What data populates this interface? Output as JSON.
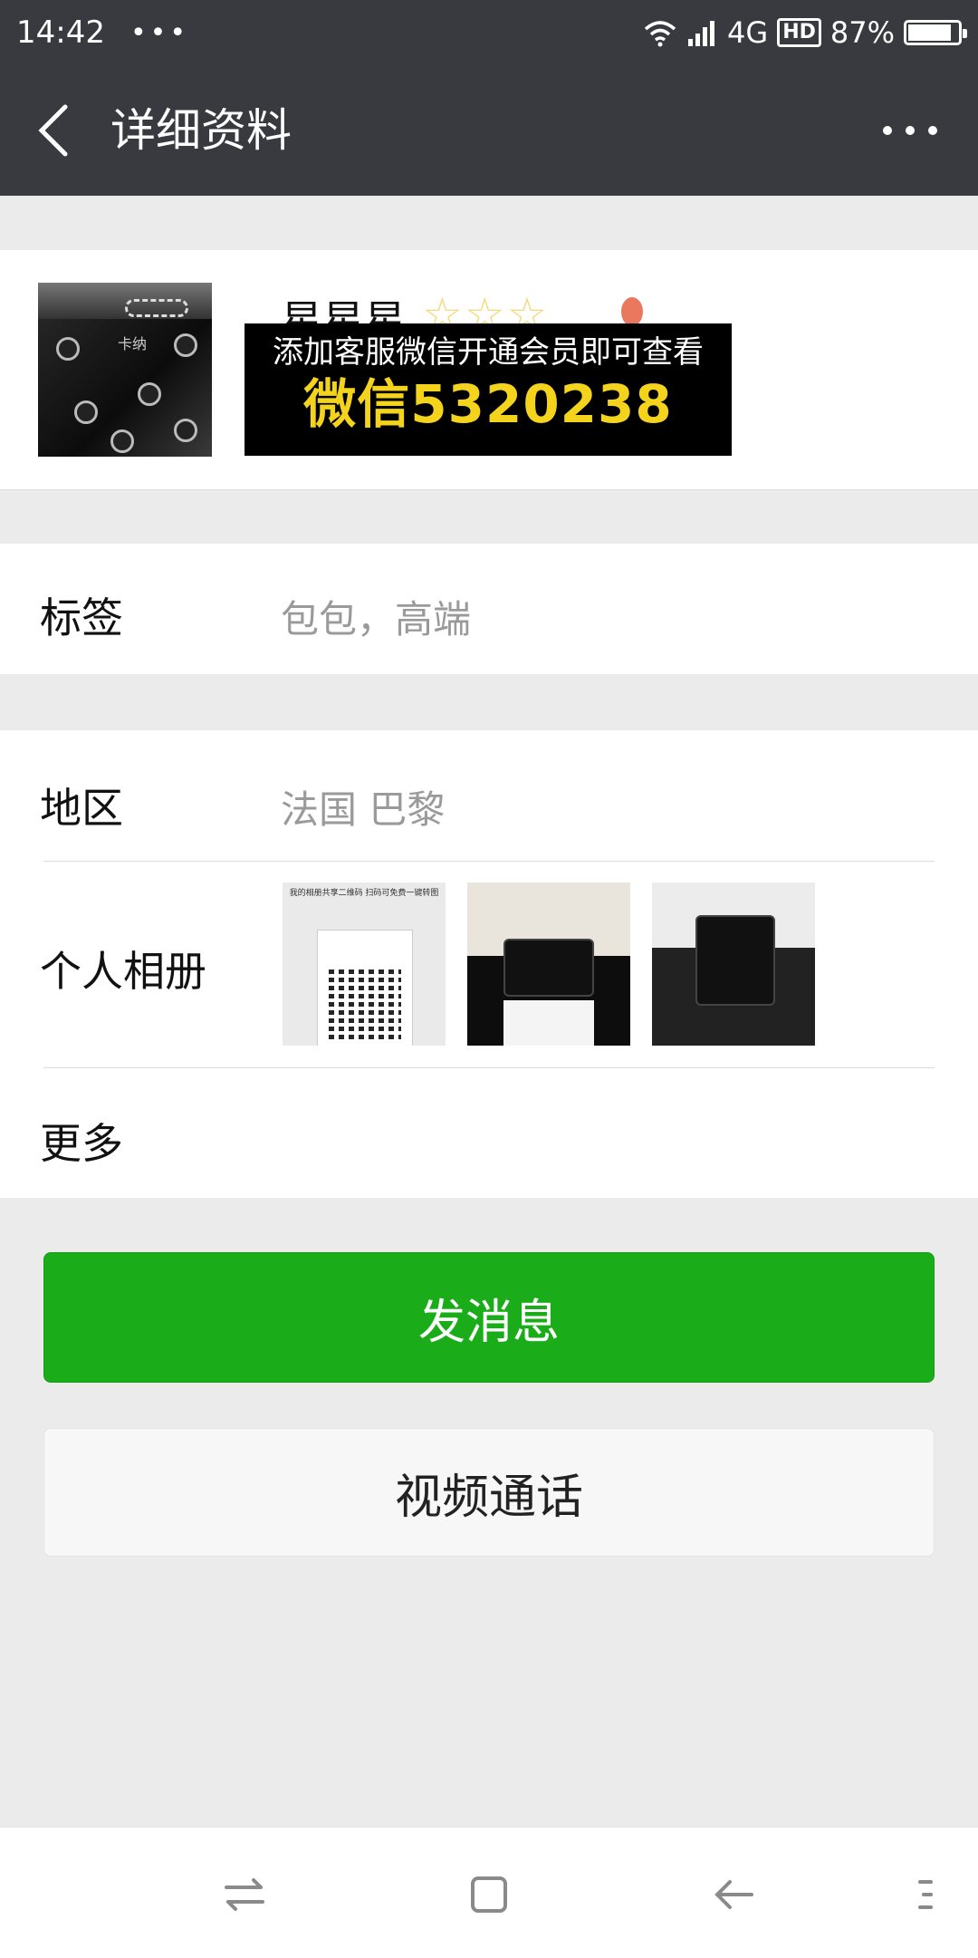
{
  "status_bar": {
    "time": "14:42",
    "dots": "•••",
    "network": "4G",
    "hd": "HD",
    "battery_text": "87%",
    "battery_level": 0.87
  },
  "nav": {
    "back_icon": "chevron-left-icon",
    "title": "详细资料",
    "more_icon": "more-dots-icon"
  },
  "profile": {
    "name": "星星星",
    "stars": "☆☆☆",
    "avatar_text": "卡纳",
    "ad_line1": "添加客服微信开通会员即可查看",
    "ad_line2": "微信5320238"
  },
  "tags": {
    "label": "标签",
    "value": "包包，高端"
  },
  "region": {
    "label": "地区",
    "value": "法国 巴黎"
  },
  "album": {
    "label": "个人相册",
    "thumb1_text": "我的相册共享二维码 扫码可免费一键转图"
  },
  "more": {
    "label": "更多"
  },
  "buttons": {
    "send_message": "发消息",
    "video_call": "视频通话"
  },
  "colors": {
    "header_bg": "#393a3f",
    "primary_green": "#1aad19",
    "page_bg": "#ebebeb",
    "ad_yellow": "#f3d31b"
  }
}
